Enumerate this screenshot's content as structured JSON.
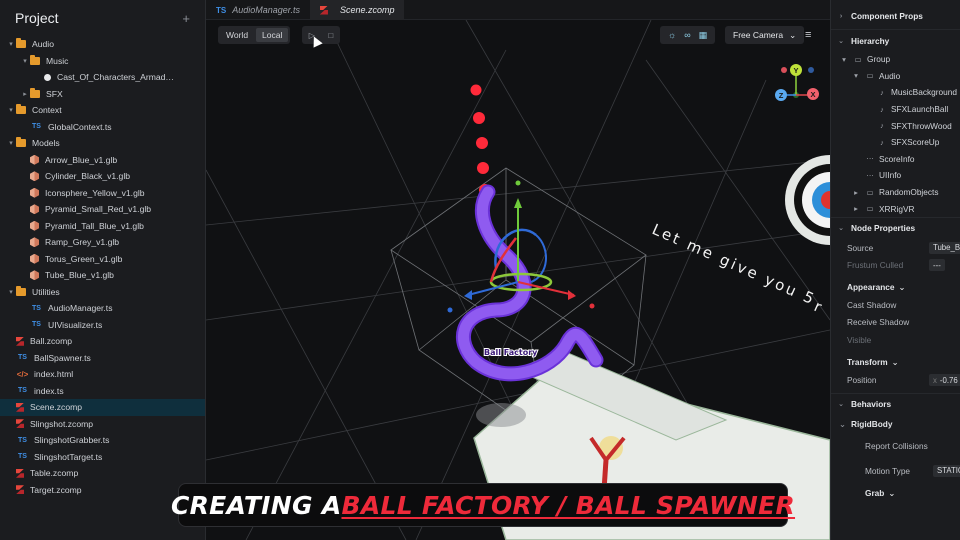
{
  "project": {
    "title": "Project",
    "add_label": "+",
    "items": [
      {
        "label": "Audio",
        "type": "folder",
        "depth": 0,
        "chev": "▾"
      },
      {
        "label": "Music",
        "type": "folder",
        "depth": 1,
        "chev": "▾"
      },
      {
        "label": "Cast_Of_Characters_Armad…",
        "type": "audio",
        "depth": 2,
        "chev": ""
      },
      {
        "label": "SFX",
        "type": "folder",
        "depth": 1,
        "chev": "▸"
      },
      {
        "label": "Context",
        "type": "folder",
        "depth": 0,
        "chev": "▾"
      },
      {
        "label": "GlobalContext.ts",
        "type": "ts",
        "depth": 1,
        "chev": ""
      },
      {
        "label": "Models",
        "type": "folder",
        "depth": 0,
        "chev": "▾"
      },
      {
        "label": "Arrow_Blue_v1.glb",
        "type": "glb",
        "depth": 1,
        "chev": ""
      },
      {
        "label": "Cylinder_Black_v1.glb",
        "type": "glb",
        "depth": 1,
        "chev": ""
      },
      {
        "label": "Iconsphere_Yellow_v1.glb",
        "type": "glb",
        "depth": 1,
        "chev": ""
      },
      {
        "label": "Pyramid_Small_Red_v1.glb",
        "type": "glb",
        "depth": 1,
        "chev": ""
      },
      {
        "label": "Pyramid_Tall_Blue_v1.glb",
        "type": "glb",
        "depth": 1,
        "chev": ""
      },
      {
        "label": "Ramp_Grey_v1.glb",
        "type": "glb",
        "depth": 1,
        "chev": ""
      },
      {
        "label": "Torus_Green_v1.glb",
        "type": "glb",
        "depth": 1,
        "chev": ""
      },
      {
        "label": "Tube_Blue_v1.glb",
        "type": "glb",
        "depth": 1,
        "chev": ""
      },
      {
        "label": "Utilities",
        "type": "folder",
        "depth": 0,
        "chev": "▾"
      },
      {
        "label": "AudioManager.ts",
        "type": "ts",
        "depth": 1,
        "chev": ""
      },
      {
        "label": "UIVisualizer.ts",
        "type": "ts",
        "depth": 1,
        "chev": ""
      },
      {
        "label": "Ball.zcomp",
        "type": "zcomp",
        "depth": 0,
        "chev": ""
      },
      {
        "label": "BallSpawner.ts",
        "type": "ts",
        "depth": 0,
        "chev": ""
      },
      {
        "label": "index.html",
        "type": "html",
        "depth": 0,
        "chev": ""
      },
      {
        "label": "index.ts",
        "type": "ts",
        "depth": 0,
        "chev": ""
      },
      {
        "label": "Scene.zcomp",
        "type": "zcomp",
        "depth": 0,
        "chev": "",
        "selected": true
      },
      {
        "label": "Slingshot.zcomp",
        "type": "zcomp",
        "depth": 0,
        "chev": ""
      },
      {
        "label": "SlingshotGrabber.ts",
        "type": "ts",
        "depth": 0,
        "chev": ""
      },
      {
        "label": "SlingshotTarget.ts",
        "type": "ts",
        "depth": 0,
        "chev": ""
      },
      {
        "label": "Table.zcomp",
        "type": "zcomp",
        "depth": 0,
        "chev": ""
      },
      {
        "label": "Target.zcomp",
        "type": "zcomp",
        "depth": 0,
        "chev": ""
      }
    ]
  },
  "tabs": [
    {
      "label": "AudioManager.ts",
      "kind": "TS",
      "active": false
    },
    {
      "label": "Scene.zcomp",
      "kind": "zcomp",
      "active": true
    }
  ],
  "toolbar": {
    "world_label": "World",
    "local_label": "Local",
    "play_icon": "▷",
    "stop_icon": "□",
    "camera_label": "Free Camera",
    "camera_chev": "⌄",
    "menu_icon": "≡"
  },
  "gizmo": {
    "y": "Y",
    "z": "Z",
    "x": "X"
  },
  "scene": {
    "floating_text": "Let me give you 5",
    "floating_suffix": "r",
    "object_label": "Ball Factory"
  },
  "banner": {
    "part1": "CREATING A ",
    "part2": "BALL FACTORY / BALL SPAWNER"
  },
  "right": {
    "component_props": "Component Props",
    "hierarchy": "Hierarchy",
    "hierarchy_items": [
      {
        "label": "Group",
        "depth": 0,
        "chev": "▾",
        "icon": "folder"
      },
      {
        "label": "Audio",
        "depth": 1,
        "chev": "▾",
        "icon": "folder"
      },
      {
        "label": "MusicBackground",
        "depth": 2,
        "chev": "",
        "icon": "note"
      },
      {
        "label": "SFXLaunchBall",
        "depth": 2,
        "chev": "",
        "icon": "note"
      },
      {
        "label": "SFXThrowWood",
        "depth": 2,
        "chev": "",
        "icon": "note"
      },
      {
        "label": "SFXScoreUp",
        "depth": 2,
        "chev": "",
        "icon": "note"
      },
      {
        "label": "ScoreInfo",
        "depth": 1,
        "chev": "",
        "icon": "dots"
      },
      {
        "label": "UIInfo",
        "depth": 1,
        "chev": "",
        "icon": "dots"
      },
      {
        "label": "RandomObjects",
        "depth": 1,
        "chev": "▸",
        "icon": "folder"
      },
      {
        "label": "XRRigVR",
        "depth": 1,
        "chev": "▸",
        "icon": "folder"
      }
    ],
    "node_properties": "Node Properties",
    "source_label": "Source",
    "source_value": "Tube_B",
    "frustum_label": "Frustum Culled",
    "frustum_value": "---",
    "appearance": "Appearance",
    "cast_shadow": "Cast Shadow",
    "receive_shadow": "Receive Shadow",
    "visible": "Visible",
    "transform": "Transform",
    "position_label": "Position",
    "position_axis": "x",
    "position_value": "-0.76",
    "behaviors": "Behaviors",
    "rigidbody": "RigidBody",
    "report_collisions": "Report Collisions",
    "motion_type": "Motion Type",
    "motion_value": "STATIC",
    "grab": "Grab"
  }
}
